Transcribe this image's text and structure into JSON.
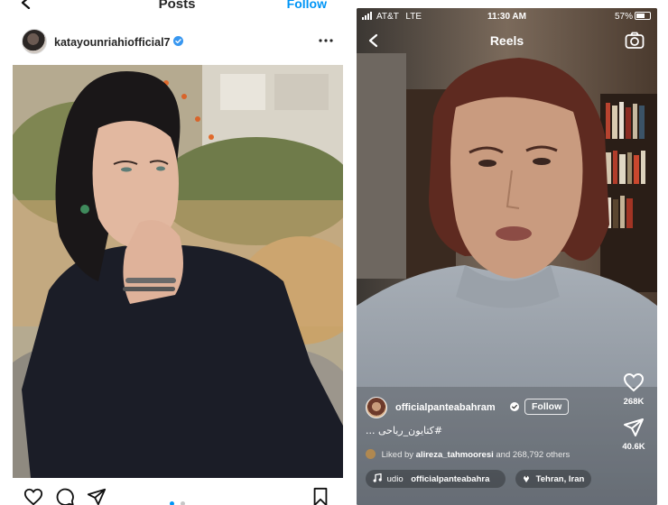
{
  "post_screen": {
    "header": {
      "title": "Posts",
      "follow_label": "Follow"
    },
    "post": {
      "username": "katayounriahiofficial7"
    },
    "actions": [
      "heart-icon",
      "comment-icon",
      "share-icon",
      "bookmark-icon"
    ],
    "carousel": {
      "pages": 2,
      "active": 1
    },
    "colors": {
      "follow": "#0095f6",
      "dot_active": "#0095f6",
      "dot_inactive": "#c7c7c7"
    }
  },
  "reels_screen": {
    "status_bar": {
      "carrier": "AT&T",
      "network": "LTE",
      "time": "11:30 AM",
      "battery": "57%"
    },
    "header": {
      "title": "Reels"
    },
    "owner": {
      "username": "officialpanteabahram",
      "follow_label": "Follow"
    },
    "caption": "#کتایون_ریاحی ...",
    "liked_by": {
      "prefix": "Liked by",
      "user": "alireza_tahmooresi",
      "suffix": "and 268,792 others"
    },
    "counts": {
      "likes": "268K",
      "shares": "40.6K"
    },
    "audio": {
      "text": "udio",
      "user": "officialpanteabahra"
    },
    "location": "Tehran, Iran"
  }
}
